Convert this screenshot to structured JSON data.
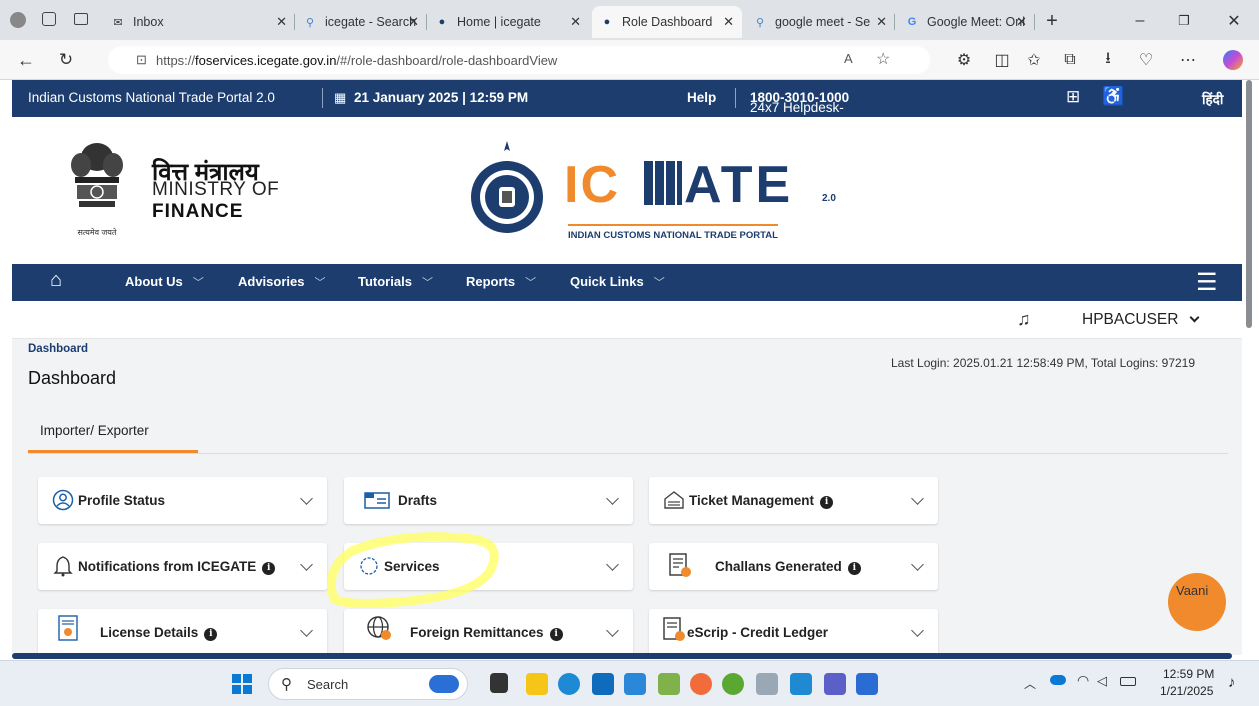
{
  "browser": {
    "tabs": [
      {
        "label": "Inbox",
        "icon": "mail-icon"
      },
      {
        "label": "icegate - Search",
        "icon": "search-icon"
      },
      {
        "label": "Home | icegate",
        "icon": "icegate-icon"
      },
      {
        "label": "Role Dashboard",
        "icon": "icegate-icon"
      },
      {
        "label": "google meet - Se",
        "icon": "search-icon"
      },
      {
        "label": "Google Meet: Onl",
        "icon": "google-icon"
      }
    ],
    "url_prefix": "https://",
    "url_host": "foservices.icegate.gov.in",
    "url_path": "/#/role-dashboard/role-dashboardView"
  },
  "topstrip": {
    "portal_name": "Indian Customs National Trade Portal 2.0",
    "date_time": "21 January 2025 | 12:59 PM",
    "help": "Help",
    "helpdesk_prefix": "24x7 Helpdesk-",
    "helpdesk_number": "1800-3010-1000",
    "hindi": "हिंदी"
  },
  "header": {
    "ministry_hindi": "वित्त मंत्रालय",
    "ministry_line1": "MINISTRY OF",
    "ministry_line2": "FINANCE",
    "emblem_motto": "सत्यमेव जयते",
    "logo_text_left": "IC",
    "logo_text_right": "ATE",
    "logo_version": "2.0",
    "logo_subtitle": "INDIAN CUSTOMS NATIONAL TRADE PORTAL"
  },
  "nav": {
    "items": [
      "About Us",
      "Advisories",
      "Tutorials",
      "Reports",
      "Quick Links"
    ]
  },
  "user": {
    "name": "HPBACUSER"
  },
  "dashboard": {
    "breadcrumb": "Dashboard",
    "title": "Dashboard",
    "last_login": "Last Login: 2025.01.21 12:58:49 PM, Total Logins: 97219",
    "tab": "Importer/ Exporter"
  },
  "cards": [
    {
      "label": "Profile Status"
    },
    {
      "label": "Drafts"
    },
    {
      "label": "Ticket Management"
    },
    {
      "label": "Notifications from ICEGATE"
    },
    {
      "label": "Services"
    },
    {
      "label": "Challans Generated"
    },
    {
      "label": "License Details"
    },
    {
      "label": "Foreign Remittances"
    },
    {
      "label": "eScrip - Credit Ledger"
    }
  ],
  "chatbot": {
    "alt": "Vaani"
  },
  "taskbar": {
    "search": "Search",
    "time": "12:59 PM",
    "date": "1/21/2025"
  },
  "colors": {
    "navy": "#1c3d6e",
    "orange": "#f08a2c",
    "highlight": "#ffff66"
  }
}
